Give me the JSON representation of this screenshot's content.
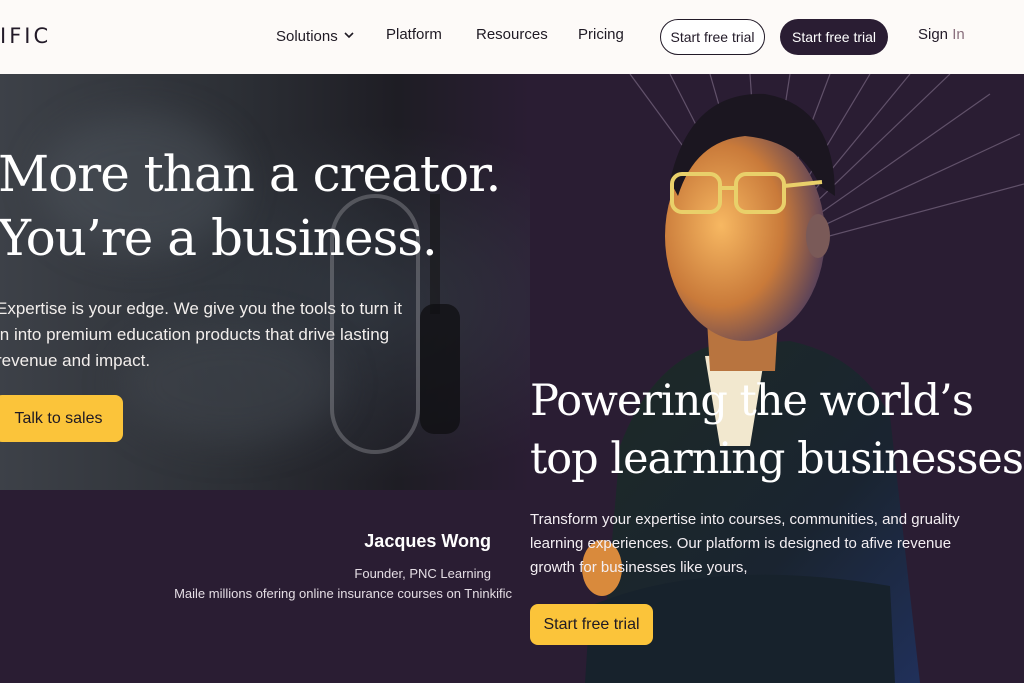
{
  "nav": {
    "logo": "IFIC",
    "links": [
      {
        "label": "Solutions"
      },
      {
        "label": "Platform"
      },
      {
        "label": "Resources"
      },
      {
        "label": "Pricing"
      }
    ],
    "trial_outline_label": "Start free trial",
    "trial_dark_label": "Start free trial",
    "signin_prefix": "Sign",
    "signin_suffix": " In"
  },
  "hero": {
    "title_line1": "More than a creator.",
    "title_line2": "You’re a business.",
    "subtitle": "Expertise is your edge. We give you the tools to turn it in into premium education products that drive lasting revenue and impact.",
    "cta_label": "Talk to sales"
  },
  "feature": {
    "title_line1": "Powering the world’s",
    "title_line2": "top learning businesses",
    "subtitle": "Transform your expertise into courses, communities, and gruality learning experiences. Our platform is designed to afive revenue growth for businesses like yours,",
    "cta_label": "Start free trial"
  },
  "testimonial": {
    "name": "Jacques Wong",
    "role": "Founder, PNC Learning",
    "quote": "Maile millions ofering online insurance courses on Tninkific"
  },
  "colors": {
    "accent_yellow": "#fbc43a",
    "brand_dark": "#2a1d33",
    "nav_bg": "#fdfaf8"
  }
}
